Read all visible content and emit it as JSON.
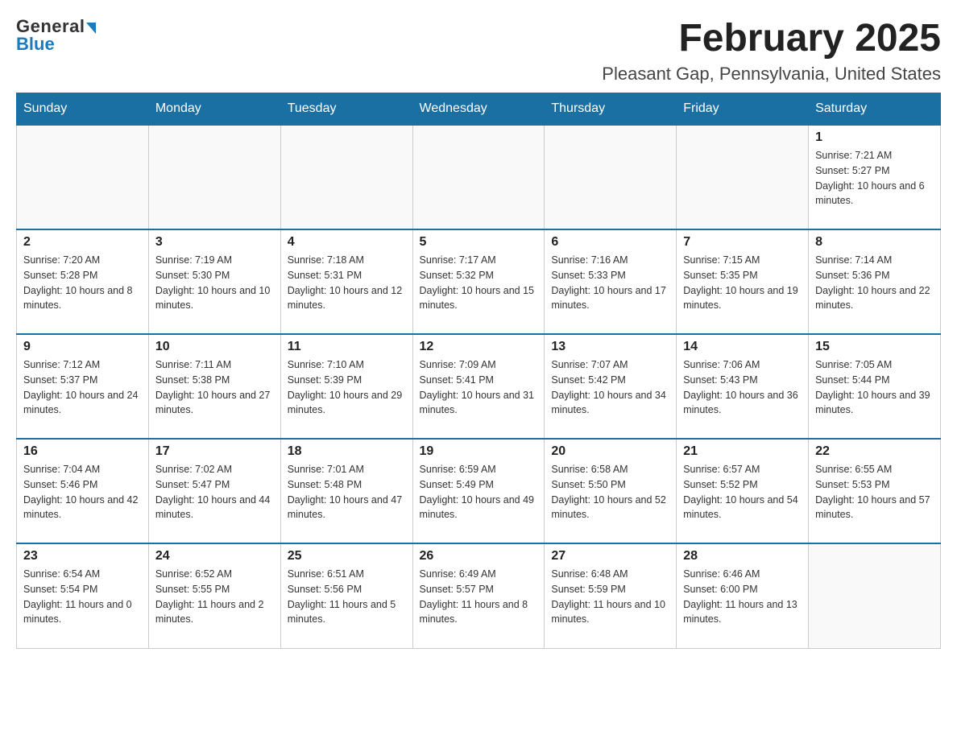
{
  "logo": {
    "general": "General",
    "blue": "Blue",
    "arrow": "▶"
  },
  "title": "February 2025",
  "location": "Pleasant Gap, Pennsylvania, United States",
  "days_of_week": [
    "Sunday",
    "Monday",
    "Tuesday",
    "Wednesday",
    "Thursday",
    "Friday",
    "Saturday"
  ],
  "weeks": [
    [
      {
        "day": "",
        "info": ""
      },
      {
        "day": "",
        "info": ""
      },
      {
        "day": "",
        "info": ""
      },
      {
        "day": "",
        "info": ""
      },
      {
        "day": "",
        "info": ""
      },
      {
        "day": "",
        "info": ""
      },
      {
        "day": "1",
        "info": "Sunrise: 7:21 AM\nSunset: 5:27 PM\nDaylight: 10 hours and 6 minutes."
      }
    ],
    [
      {
        "day": "2",
        "info": "Sunrise: 7:20 AM\nSunset: 5:28 PM\nDaylight: 10 hours and 8 minutes."
      },
      {
        "day": "3",
        "info": "Sunrise: 7:19 AM\nSunset: 5:30 PM\nDaylight: 10 hours and 10 minutes."
      },
      {
        "day": "4",
        "info": "Sunrise: 7:18 AM\nSunset: 5:31 PM\nDaylight: 10 hours and 12 minutes."
      },
      {
        "day": "5",
        "info": "Sunrise: 7:17 AM\nSunset: 5:32 PM\nDaylight: 10 hours and 15 minutes."
      },
      {
        "day": "6",
        "info": "Sunrise: 7:16 AM\nSunset: 5:33 PM\nDaylight: 10 hours and 17 minutes."
      },
      {
        "day": "7",
        "info": "Sunrise: 7:15 AM\nSunset: 5:35 PM\nDaylight: 10 hours and 19 minutes."
      },
      {
        "day": "8",
        "info": "Sunrise: 7:14 AM\nSunset: 5:36 PM\nDaylight: 10 hours and 22 minutes."
      }
    ],
    [
      {
        "day": "9",
        "info": "Sunrise: 7:12 AM\nSunset: 5:37 PM\nDaylight: 10 hours and 24 minutes."
      },
      {
        "day": "10",
        "info": "Sunrise: 7:11 AM\nSunset: 5:38 PM\nDaylight: 10 hours and 27 minutes."
      },
      {
        "day": "11",
        "info": "Sunrise: 7:10 AM\nSunset: 5:39 PM\nDaylight: 10 hours and 29 minutes."
      },
      {
        "day": "12",
        "info": "Sunrise: 7:09 AM\nSunset: 5:41 PM\nDaylight: 10 hours and 31 minutes."
      },
      {
        "day": "13",
        "info": "Sunrise: 7:07 AM\nSunset: 5:42 PM\nDaylight: 10 hours and 34 minutes."
      },
      {
        "day": "14",
        "info": "Sunrise: 7:06 AM\nSunset: 5:43 PM\nDaylight: 10 hours and 36 minutes."
      },
      {
        "day": "15",
        "info": "Sunrise: 7:05 AM\nSunset: 5:44 PM\nDaylight: 10 hours and 39 minutes."
      }
    ],
    [
      {
        "day": "16",
        "info": "Sunrise: 7:04 AM\nSunset: 5:46 PM\nDaylight: 10 hours and 42 minutes."
      },
      {
        "day": "17",
        "info": "Sunrise: 7:02 AM\nSunset: 5:47 PM\nDaylight: 10 hours and 44 minutes."
      },
      {
        "day": "18",
        "info": "Sunrise: 7:01 AM\nSunset: 5:48 PM\nDaylight: 10 hours and 47 minutes."
      },
      {
        "day": "19",
        "info": "Sunrise: 6:59 AM\nSunset: 5:49 PM\nDaylight: 10 hours and 49 minutes."
      },
      {
        "day": "20",
        "info": "Sunrise: 6:58 AM\nSunset: 5:50 PM\nDaylight: 10 hours and 52 minutes."
      },
      {
        "day": "21",
        "info": "Sunrise: 6:57 AM\nSunset: 5:52 PM\nDaylight: 10 hours and 54 minutes."
      },
      {
        "day": "22",
        "info": "Sunrise: 6:55 AM\nSunset: 5:53 PM\nDaylight: 10 hours and 57 minutes."
      }
    ],
    [
      {
        "day": "23",
        "info": "Sunrise: 6:54 AM\nSunset: 5:54 PM\nDaylight: 11 hours and 0 minutes."
      },
      {
        "day": "24",
        "info": "Sunrise: 6:52 AM\nSunset: 5:55 PM\nDaylight: 11 hours and 2 minutes."
      },
      {
        "day": "25",
        "info": "Sunrise: 6:51 AM\nSunset: 5:56 PM\nDaylight: 11 hours and 5 minutes."
      },
      {
        "day": "26",
        "info": "Sunrise: 6:49 AM\nSunset: 5:57 PM\nDaylight: 11 hours and 8 minutes."
      },
      {
        "day": "27",
        "info": "Sunrise: 6:48 AM\nSunset: 5:59 PM\nDaylight: 11 hours and 10 minutes."
      },
      {
        "day": "28",
        "info": "Sunrise: 6:46 AM\nSunset: 6:00 PM\nDaylight: 11 hours and 13 minutes."
      },
      {
        "day": "",
        "info": ""
      }
    ]
  ]
}
